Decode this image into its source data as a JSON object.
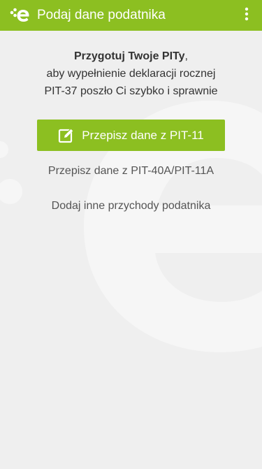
{
  "header": {
    "title": "Podaj dane podatnika",
    "logo_icon": "e-pity-logo-icon",
    "menu_icon": "more-vertical-icon"
  },
  "intro": {
    "bold_text": "Przygotuj Twoje PITy",
    "comma": ",",
    "line2": "aby wypełnienie deklaracji rocznej",
    "line3": "PIT-37 poszło Ci szybko i sprawnie"
  },
  "actions": {
    "primary_label": "Przepisz dane z PIT-11",
    "primary_icon": "edit-icon",
    "pit40_label": "Przepisz dane z PIT-40A/PIT-11A",
    "other_income_label": "Dodaj inne przychody podatnika"
  },
  "colors": {
    "accent": "#8cbf21",
    "background": "#efefef",
    "text": "#333333"
  }
}
